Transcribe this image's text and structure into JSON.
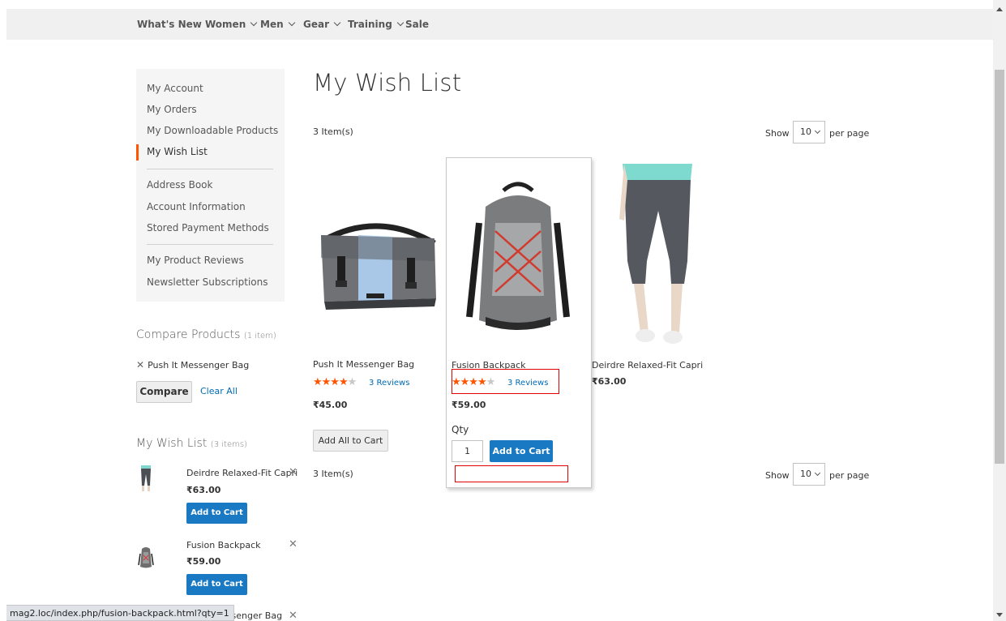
{
  "nav": {
    "items": [
      {
        "label": "What's New",
        "has_dropdown": false
      },
      {
        "label": "Women",
        "has_dropdown": true
      },
      {
        "label": "Men",
        "has_dropdown": true
      },
      {
        "label": "Gear",
        "has_dropdown": true
      },
      {
        "label": "Training",
        "has_dropdown": true
      },
      {
        "label": "Sale",
        "has_dropdown": false
      }
    ]
  },
  "account_nav": {
    "items": [
      "My Account",
      "My Orders",
      "My Downloadable Products",
      "My Wish List",
      "Address Book",
      "Account Information",
      "Stored Payment Methods",
      "My Product Reviews",
      "Newsletter Subscriptions"
    ],
    "current": "My Wish List",
    "accent_color": "#ff5501"
  },
  "compare": {
    "title": "Compare Products",
    "count": "(1 item)",
    "items": [
      "Push It Messenger Bag"
    ],
    "compare_label": "Compare",
    "clear_label": "Clear All"
  },
  "sidebar_wishlist": {
    "title": "My Wish List",
    "count": "(3 items)",
    "items": [
      {
        "name": "Deirdre Relaxed-Fit Capri",
        "price": "₹63.00",
        "button": "Add to Cart"
      },
      {
        "name": "Fusion Backpack",
        "price": "₹59.00",
        "button": "Add to Cart"
      },
      {
        "name": "Push It Messenger Bag",
        "partial_text": "lessenger Bag"
      }
    ]
  },
  "main": {
    "title": "My Wish List",
    "amount_top": "3 Item(s)",
    "amount_bottom": "3 Item(s)",
    "limiter": {
      "show": "Show",
      "value": "10",
      "per_page": "per page"
    },
    "add_all_label": "Add All to Cart",
    "products": [
      {
        "name": "Push It Messenger Bag",
        "price": "₹45.00",
        "rating": 3.5,
        "reviews": "3 Reviews"
      },
      {
        "name": "Fusion Backpack",
        "price": "₹59.00",
        "rating": 3.5,
        "reviews": "3 Reviews",
        "qty_label": "Qty",
        "qty": "1",
        "cart_label": "Add to Cart"
      },
      {
        "name": "Deirdre Relaxed-Fit Capri",
        "price": "₹63.00"
      }
    ]
  },
  "statusbar": {
    "url": "mag2.loc/index.php/fusion-backpack.html?qty=1"
  },
  "colors": {
    "primary_button": "#1979c3",
    "link": "#006bb4",
    "star": "#ff5501",
    "annotation": "#e00000"
  }
}
